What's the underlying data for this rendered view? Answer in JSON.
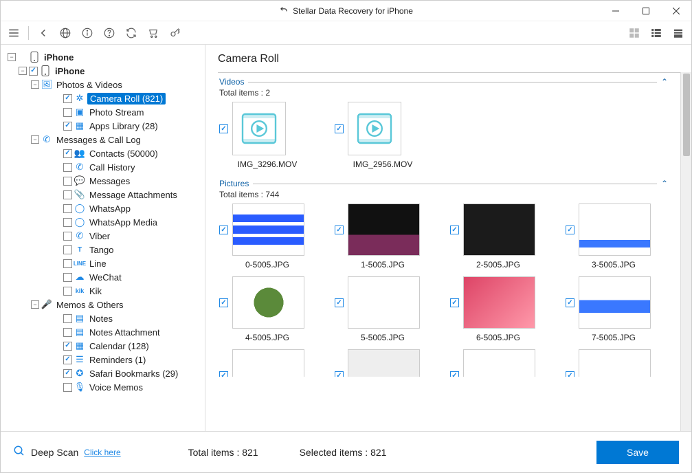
{
  "window": {
    "title": "Stellar Data Recovery for iPhone"
  },
  "tree": {
    "root": {
      "label": "iPhone",
      "expanded": "−"
    },
    "device": {
      "label": "iPhone",
      "checked": true,
      "expanded": "−"
    },
    "photos_group": {
      "label": "Photos & Videos",
      "expanded": "−",
      "icon": "image"
    },
    "camera_roll": {
      "label": "Camera Roll (821)",
      "checked": true,
      "icon": "aperture"
    },
    "photo_stream": {
      "label": "Photo Stream",
      "checked": false,
      "icon": "photo"
    },
    "apps_library": {
      "label": "Apps Library (28)",
      "checked": true,
      "icon": "grid"
    },
    "msgs_group": {
      "label": "Messages & Call Log",
      "expanded": "−",
      "icon": "phone"
    },
    "contacts": {
      "label": "Contacts (50000)",
      "checked": true,
      "icon": "contacts"
    },
    "call_history": {
      "label": "Call History",
      "checked": false,
      "icon": "phone"
    },
    "messages": {
      "label": "Messages",
      "checked": false,
      "icon": "chat"
    },
    "msg_attach": {
      "label": "Message Attachments",
      "checked": false,
      "icon": "attach"
    },
    "whatsapp": {
      "label": "WhatsApp",
      "checked": false,
      "icon": "whatsapp"
    },
    "whatsapp_media": {
      "label": "WhatsApp Media",
      "checked": false,
      "icon": "whatsapp"
    },
    "viber": {
      "label": "Viber",
      "checked": false,
      "icon": "viber"
    },
    "tango": {
      "label": "Tango",
      "checked": false,
      "icon": "tango"
    },
    "line": {
      "label": "Line",
      "checked": false,
      "icon": "line"
    },
    "wechat": {
      "label": "WeChat",
      "checked": false,
      "icon": "wechat"
    },
    "kik": {
      "label": "Kik",
      "checked": false,
      "icon": "kik"
    },
    "memos_group": {
      "label": "Memos & Others",
      "expanded": "−",
      "icon": "mic"
    },
    "notes": {
      "label": "Notes",
      "checked": false,
      "icon": "note"
    },
    "notes_attach": {
      "label": "Notes Attachment",
      "checked": false,
      "icon": "note"
    },
    "calendar": {
      "label": "Calendar (128)",
      "checked": true,
      "icon": "calendar"
    },
    "reminders": {
      "label": "Reminders (1)",
      "checked": true,
      "icon": "list"
    },
    "safari": {
      "label": "Safari Bookmarks (29)",
      "checked": true,
      "icon": "safari"
    },
    "voice_memos": {
      "label": "Voice Memos",
      "checked": false,
      "icon": "mic"
    }
  },
  "content": {
    "title": "Camera Roll",
    "videos_label": "Videos",
    "videos_total": "Total items : 2",
    "pictures_label": "Pictures",
    "pictures_total": "Total items : 744",
    "videos": [
      {
        "name": "IMG_3296.MOV"
      },
      {
        "name": "IMG_2956.MOV"
      }
    ],
    "pictures": [
      {
        "name": "0-5005.JPG"
      },
      {
        "name": "1-5005.JPG"
      },
      {
        "name": "2-5005.JPG"
      },
      {
        "name": "3-5005.JPG"
      },
      {
        "name": "4-5005.JPG"
      },
      {
        "name": "5-5005.JPG"
      },
      {
        "name": "6-5005.JPG"
      },
      {
        "name": "7-5005.JPG"
      }
    ]
  },
  "footer": {
    "deep_scan": "Deep Scan",
    "click_here": "Click here",
    "total": "Total items : 821",
    "selected": "Selected items : 821",
    "save": "Save"
  }
}
